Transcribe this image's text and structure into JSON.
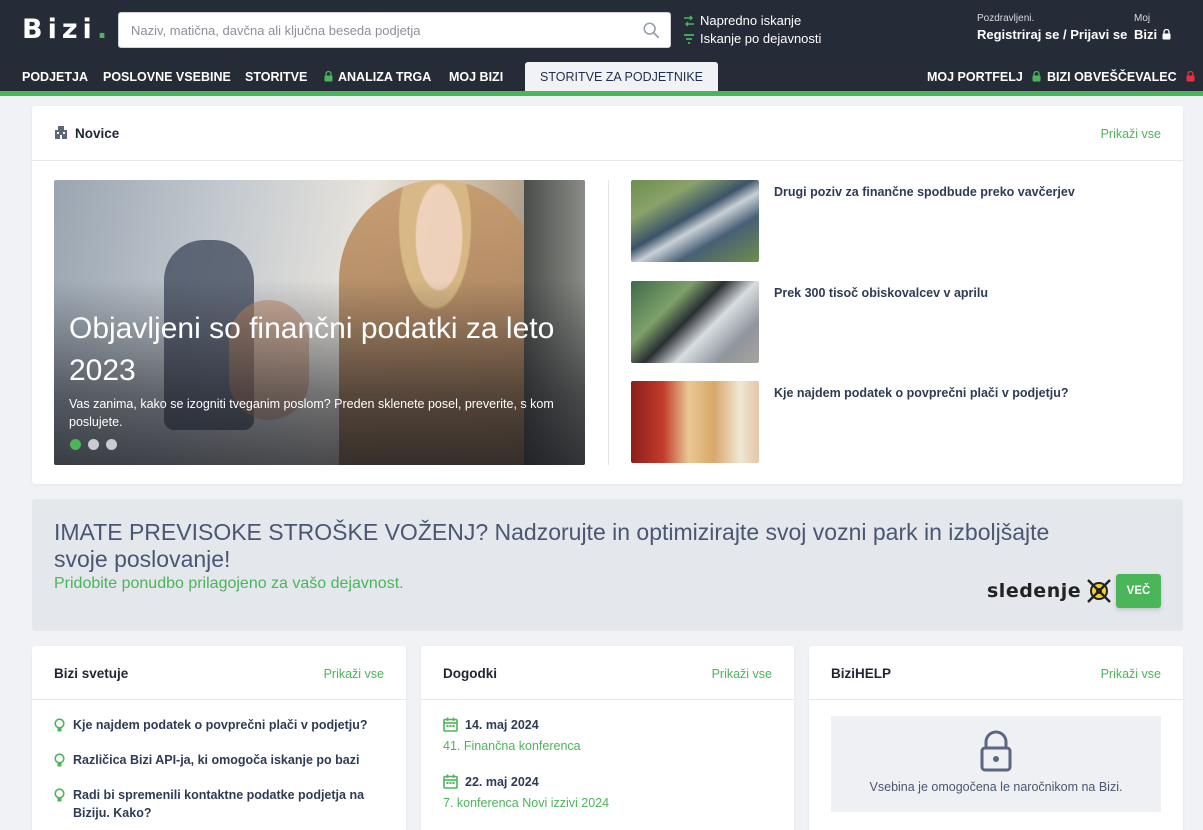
{
  "header": {
    "logo": "Bizi",
    "logo_dot": ".",
    "search_placeholder": "Naziv, matična, davčna ali ključna beseda podjetja",
    "advanced_search": "Napredno iskanje",
    "search_by_activity": "Iskanje po dejavnosti",
    "greeting": "Pozdravljeni.",
    "login": "Registriraj se / Prijavi se",
    "my_label": "Moj",
    "my_bizi": "Bizi"
  },
  "nav": {
    "items": [
      "PODJETJA",
      "POSLOVNE VSEBINE",
      "STORITVE",
      "ANALIZA TRGA",
      "MOJ BIZI",
      "STORITVE ZA PODJETNIKE"
    ],
    "right": [
      "MOJ PORTFELJ",
      "BIZI OBVEŠČEVALEC"
    ]
  },
  "news": {
    "title": "Novice",
    "show_all": "Prikaži vse",
    "hero_title": "Objavljeni so finančni podatki za leto 2023",
    "hero_desc": "Vas zanima, kako se izogniti tveganim poslom? Preden sklenete posel, preverite, s kom poslujete.",
    "items": [
      "Drugi poziv za finančne spodbude preko vavčerjev",
      "Prek 300 tisoč obiskovalcev v aprilu",
      "Kje najdem podatek o povprečni plači v podjetju?"
    ]
  },
  "banner": {
    "title": "IMATE PREVISOKE STROŠKE VOŽENJ? Nadzorujte in optimizirajte svoj vozni park in izboljšajte svoje poslovanje!",
    "subtitle": "Pridobite ponudbo prilagojeno za vašo dejavnost.",
    "brand": "sledenje",
    "button": "VEČ"
  },
  "advice": {
    "title": "Bizi svetuje",
    "show_all": "Prikaži vse",
    "items": [
      "Kje najdem podatek o povprečni plači v podjetju?",
      "Različica Bizi API-ja, ki omogoča iskanje po bazi",
      "Radi bi spremenili kontaktne podatke podjetja na Biziju. Kako?"
    ]
  },
  "events": {
    "title": "Dogodki",
    "show_all": "Prikaži vse",
    "items": [
      {
        "date": "14. maj 2024",
        "name": "41. Finančna konferenca"
      },
      {
        "date": "22. maj 2024",
        "name": "7. konferenca Novi izzivi 2024"
      }
    ]
  },
  "help": {
    "title": "BiziHELP",
    "show_all": "Prikaži vse",
    "locked_msg": "Vsebina je omogočena le naročnikom na Bizi."
  },
  "colors": {
    "header_bg": "#262b38",
    "accent": "#4bb55a",
    "lock_red": "#e0353a",
    "page_bg": "#f1f2f5"
  }
}
